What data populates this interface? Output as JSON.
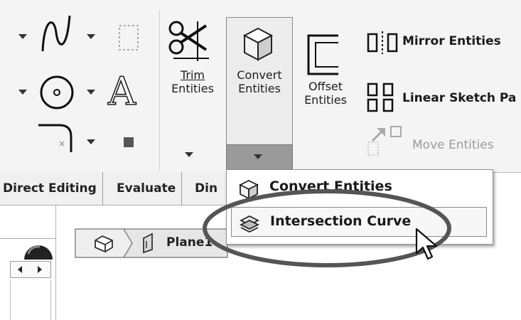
{
  "ribbon": {
    "trim": {
      "line1": "Trim",
      "line2": "Entities"
    },
    "convert": {
      "line1": "Convert",
      "line2": "Entities"
    },
    "offset": {
      "line1": "Offset",
      "line2": "Entities"
    },
    "mirror_label": "Mirror Entities",
    "linear_label": "Linear Sketch Pa",
    "move_label": "Move Entities",
    "text_tool_glyph": "A"
  },
  "tabs": [
    "Direct Editing",
    "Evaluate",
    "Din"
  ],
  "dropdown": {
    "items": [
      {
        "label": "Convert Entities",
        "icon": "convert-entities-icon"
      },
      {
        "label": "Intersection Curve",
        "icon": "intersection-curve-icon"
      }
    ]
  },
  "breadcrumb": {
    "label": "Plane1",
    "part_icon": "part-icon",
    "plane_icon": "plane-icon"
  },
  "colors": {
    "ribbon_bg": "#f4f4f4",
    "selected_group": "#ececec",
    "dropdown_arrow_bg": "#9a9a9a",
    "callout_ellipse": "#555555"
  }
}
